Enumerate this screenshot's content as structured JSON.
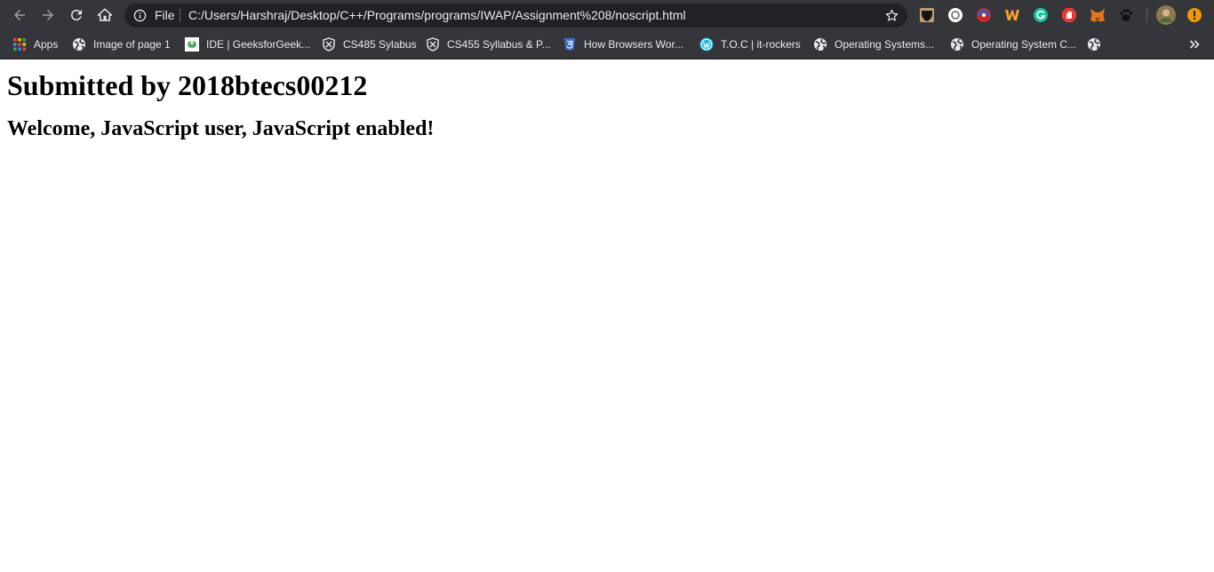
{
  "browser": {
    "omnibox": {
      "scheme_label": "File",
      "url": "C:/Users/Harshraj/Desktop/C++/Programs/programs/IWAP/Assignment%208/noscript.html"
    },
    "nav_icons": [
      "back-icon",
      "forward-icon",
      "reload-icon",
      "home-icon"
    ],
    "extensions": [
      "dark-reader-extension-icon",
      "circle-extension-icon",
      "vpn-extension-icon",
      "w-extension-icon",
      "grammarly-extension-icon",
      "adblock-extension-icon",
      "metamask-extension-icon",
      "paw-extension-icon"
    ],
    "accent_color": "#35363a"
  },
  "bookmarks": [
    {
      "label": "Apps",
      "icon": "apps-grid-icon"
    },
    {
      "label": "Image of page 1",
      "icon": "globe-icon"
    },
    {
      "label": "IDE | GeeksforGeek...",
      "icon": "geeksforgeeks-icon"
    },
    {
      "label": "CS485 Sylabus",
      "icon": "shield-icon"
    },
    {
      "label": "CS455 Syllabus & P...",
      "icon": "shield-icon"
    },
    {
      "label": "How Browsers Wor...",
      "icon": "html5-icon"
    },
    {
      "label": "T.O.C | it-rockers",
      "icon": "wordpress-icon"
    },
    {
      "label": "Operating Systems...",
      "icon": "globe-icon"
    },
    {
      "label": "Operating System C...",
      "icon": "globe-icon"
    },
    {
      "label": "",
      "icon": "globe-icon"
    }
  ],
  "page": {
    "heading": "Submitted by 2018btecs00212",
    "message": "Welcome, JavaScript user, JavaScript enabled!"
  }
}
